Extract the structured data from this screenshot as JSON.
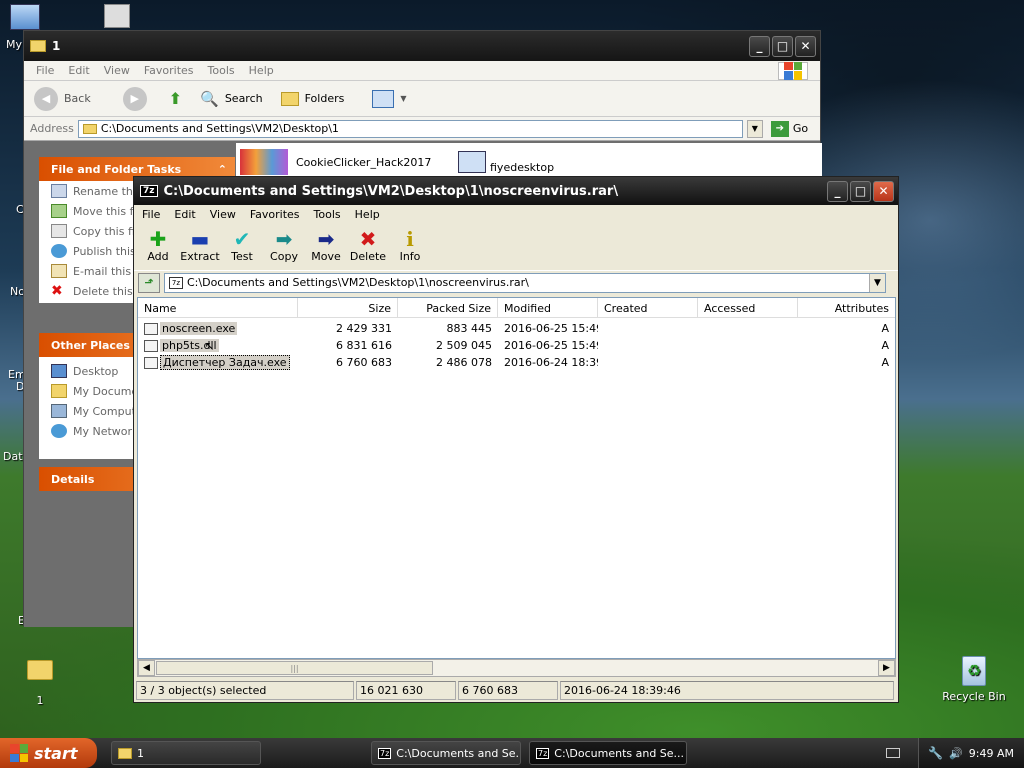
{
  "desktop": {
    "icons": [
      {
        "name": "My",
        "label": "My"
      },
      {
        "name": "folder-1",
        "label": "1"
      },
      {
        "name": "recycle-bin",
        "label": "Recycle Bin"
      }
    ],
    "left_edge_labels": [
      "C",
      "No",
      "Em",
      "D",
      "Dat",
      "E"
    ]
  },
  "explorer": {
    "title": "1",
    "menu": [
      "File",
      "Edit",
      "View",
      "Favorites",
      "Tools",
      "Help"
    ],
    "toolbar": {
      "back": "Back",
      "search": "Search",
      "folders": "Folders"
    },
    "address_label": "Address",
    "address": "C:\\Documents and Settings\\VM2\\Desktop\\1",
    "go": "Go",
    "file_tasks": {
      "title": "File and Folder Tasks",
      "items": [
        "Rename this",
        "Move this fil",
        "Copy this fil",
        "Publish this",
        "E-mail this f",
        "Delete this f"
      ]
    },
    "other_places": {
      "title": "Other Places",
      "items": [
        "Desktop",
        "My Documer",
        "My Compute",
        "My Network"
      ]
    },
    "details": {
      "title": "Details"
    },
    "content_items": [
      "CookieClicker_Hack2017",
      "fiyedesktop"
    ]
  },
  "zip": {
    "title": "C:\\Documents and Settings\\VM2\\Desktop\\1\\noscreenvirus.rar\\",
    "menu": [
      "File",
      "Edit",
      "View",
      "Favorites",
      "Tools",
      "Help"
    ],
    "toolbar": [
      {
        "label": "Add",
        "icon": "plus-icon",
        "glyph": "✚",
        "color": "#1aa31a"
      },
      {
        "label": "Extract",
        "icon": "minus-icon",
        "glyph": "▬",
        "color": "#1a3fb0"
      },
      {
        "label": "Test",
        "icon": "check-icon",
        "glyph": "✔",
        "color": "#1fb7b7"
      },
      {
        "label": "Copy",
        "icon": "copy-arrow-icon",
        "glyph": "➡",
        "color": "#1a8a8a"
      },
      {
        "label": "Move",
        "icon": "move-arrow-icon",
        "glyph": "➡",
        "color": "#1a2a8a"
      },
      {
        "label": "Delete",
        "icon": "delete-x-icon",
        "glyph": "✖",
        "color": "#d11a1a"
      },
      {
        "label": "Info",
        "icon": "info-icon",
        "glyph": "i",
        "color": "#b89a00"
      }
    ],
    "address": "C:\\Documents and Settings\\VM2\\Desktop\\1\\noscreenvirus.rar\\",
    "columns": [
      "Name",
      "Size",
      "Packed Size",
      "Modified",
      "Created",
      "Accessed",
      "Attributes"
    ],
    "rows": [
      {
        "name": "noscreen.exe",
        "size": "2 429 331",
        "packed": "883 445",
        "modified": "2016-06-25 15:49",
        "created": "",
        "accessed": "",
        "attr": "A"
      },
      {
        "name": "php5ts.dll",
        "size": "6 831 616",
        "packed": "2 509 045",
        "modified": "2016-06-25 15:49",
        "created": "",
        "accessed": "",
        "attr": "A"
      },
      {
        "name": "Диспетчер Задач.exe",
        "size": "6 760 683",
        "packed": "2 486 078",
        "modified": "2016-06-24 18:39",
        "created": "",
        "accessed": "",
        "attr": "A"
      }
    ],
    "status": [
      "3 / 3 object(s) selected",
      "16 021 630",
      "6 760 683",
      "2016-06-24 18:39:46"
    ]
  },
  "taskbar": {
    "start": "start",
    "tasks": [
      "1",
      "C:\\Documents and Se...",
      "C:\\Documents and Se..."
    ],
    "clock": "9:49 AM"
  }
}
